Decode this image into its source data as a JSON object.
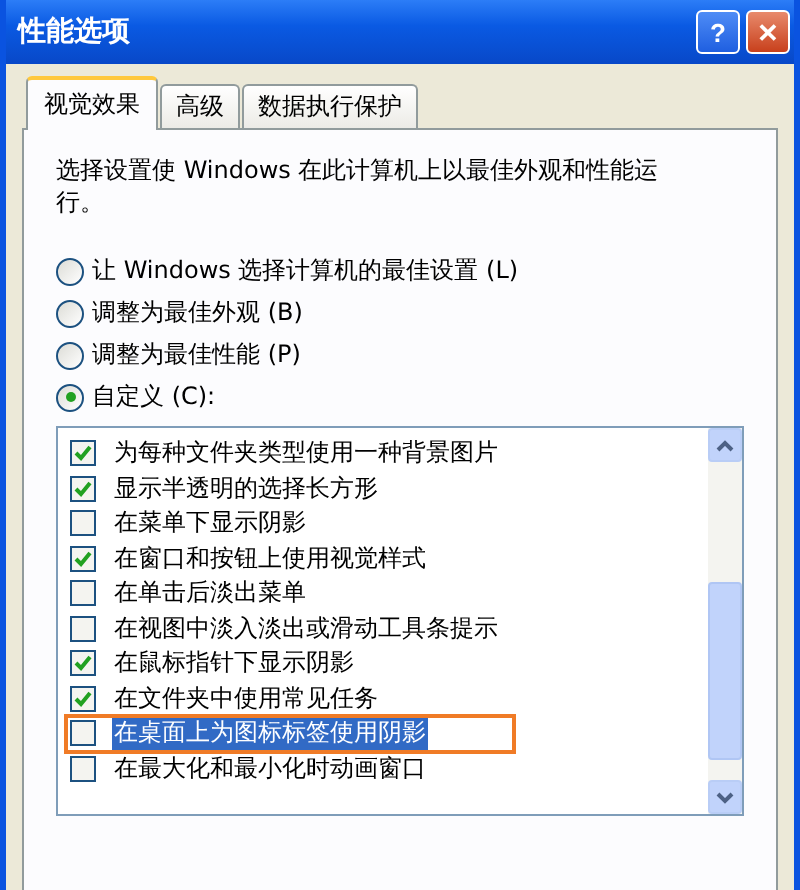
{
  "window": {
    "title": "性能选项",
    "buttons": [
      {
        "kind": "help",
        "label": "?"
      },
      {
        "kind": "close",
        "label": "✕"
      }
    ]
  },
  "tabs": [
    {
      "label": "视觉效果",
      "selected": true
    },
    {
      "label": "高级",
      "selected": false
    },
    {
      "label": "数据执行保护",
      "selected": false
    }
  ],
  "description": "选择设置使 Windows 在此计算机上以最佳外观和性能运行。",
  "radios": [
    {
      "label": "让 Windows 选择计算机的最佳设置 (L)",
      "selected": false
    },
    {
      "label": "调整为最佳外观 (B)",
      "selected": false
    },
    {
      "label": "调整为最佳性能 (P)",
      "selected": false
    },
    {
      "label": "自定义 (C):",
      "selected": true
    }
  ],
  "effects": [
    {
      "label": "为每种文件夹类型使用一种背景图片",
      "checked": true,
      "selected": false
    },
    {
      "label": "显示半透明的选择长方形",
      "checked": true,
      "selected": false
    },
    {
      "label": "在菜单下显示阴影",
      "checked": false,
      "selected": false
    },
    {
      "label": "在窗口和按钮上使用视觉样式",
      "checked": true,
      "selected": false
    },
    {
      "label": "在单击后淡出菜单",
      "checked": false,
      "selected": false
    },
    {
      "label": "在视图中淡入淡出或滑动工具条提示",
      "checked": false,
      "selected": false
    },
    {
      "label": "在鼠标指针下显示阴影",
      "checked": true,
      "selected": false
    },
    {
      "label": "在文件夹中使用常见任务",
      "checked": true,
      "selected": false
    },
    {
      "label": "在桌面上为图标标签使用阴影",
      "checked": false,
      "selected": true
    },
    {
      "label": "在最大化和最小化时动画窗口",
      "checked": false,
      "selected": false
    }
  ]
}
